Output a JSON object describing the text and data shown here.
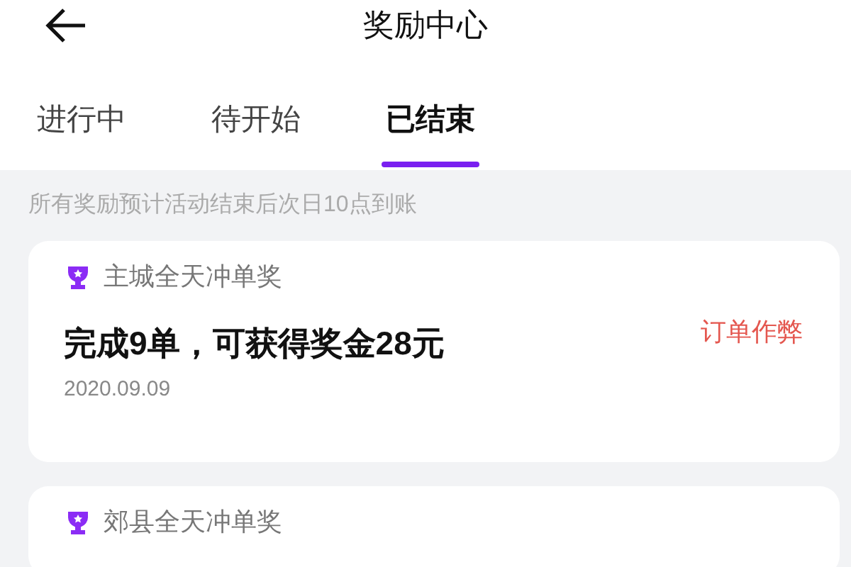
{
  "header": {
    "title": "奖励中心"
  },
  "tabs": [
    {
      "label": "进行中",
      "selected": false
    },
    {
      "label": "待开始",
      "selected": false
    },
    {
      "label": "已结束",
      "selected": true
    }
  ],
  "notice": "所有奖励预计活动结束后次日10点到账",
  "rewards": [
    {
      "title": "主城全天冲单奖",
      "description": "完成9单，可获得奖金28元",
      "status": "订单作弊",
      "date": "2020.09.09"
    },
    {
      "title": "郊县全天冲单奖"
    }
  ]
}
